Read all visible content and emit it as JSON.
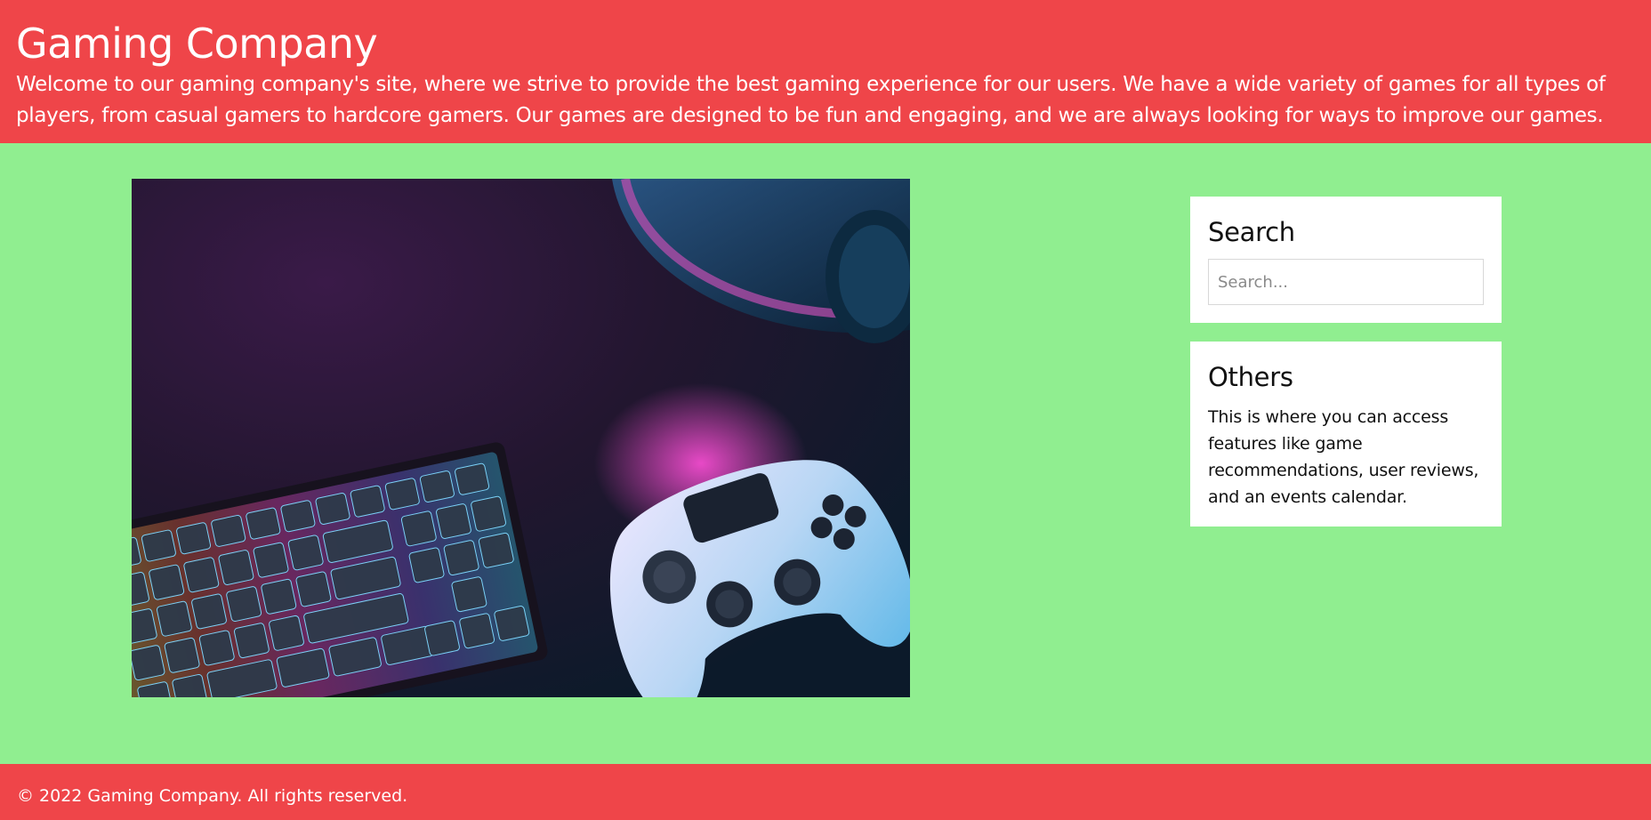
{
  "header": {
    "title": "Gaming Company",
    "intro": "Welcome to our gaming company's site, where we strive to provide the best gaming experience for our users. We have a wide variety of games for all types of players, from casual gamers to hardcore gamers. Our games are designed to be fun and engaging, and we are always looking for ways to improve our games."
  },
  "hero": {
    "image_subject": "keyboard-and-game-controller-photo"
  },
  "sidebar": {
    "search": {
      "title": "Search",
      "placeholder": "Search...",
      "value": ""
    },
    "others": {
      "title": "Others",
      "text": "This is where you can access features like game recommendations, user reviews, and an events calendar."
    }
  },
  "footer": {
    "copyright": "© 2022 Gaming Company. All rights reserved."
  },
  "colors": {
    "header_bg": "#ef4549",
    "page_bg": "#90ee90",
    "widget_bg": "#ffffff"
  }
}
